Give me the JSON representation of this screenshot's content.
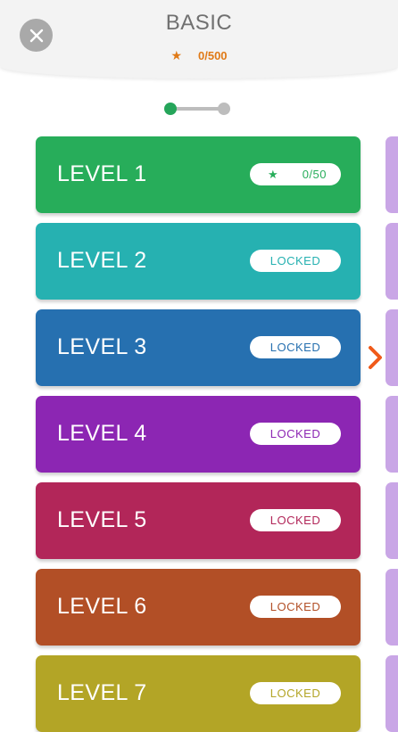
{
  "header": {
    "title": "BASIC",
    "progress_text": "0/500",
    "star_icon": "★"
  },
  "levels": [
    {
      "label": "LEVEL 1",
      "status": "0/50",
      "color": "#27ad5a",
      "text_color": "#27ad5a",
      "star_icon": "★"
    },
    {
      "label": "LEVEL 2",
      "status": "LOCKED",
      "color": "#26b1b1",
      "text_color": "#26b1b1"
    },
    {
      "label": "LEVEL 3",
      "status": "LOCKED",
      "color": "#2670b0",
      "text_color": "#2670b0"
    },
    {
      "label": "LEVEL 4",
      "status": "LOCKED",
      "color": "#8c26b3",
      "text_color": "#8c26b3"
    },
    {
      "label": "LEVEL 5",
      "status": "LOCKED",
      "color": "#b22659",
      "text_color": "#b22659"
    },
    {
      "label": "LEVEL 6",
      "status": "LOCKED",
      "color": "#b24f26",
      "text_color": "#b24f26"
    },
    {
      "label": "LEVEL 7",
      "status": "LOCKED",
      "color": "#b3a526",
      "text_color": "#b3a526"
    }
  ],
  "icons": {
    "close": "close-icon",
    "next": "chevron-right-icon"
  },
  "colors": {
    "accent_orange": "#e07a17",
    "next_page_card": "#c9a6e6"
  }
}
